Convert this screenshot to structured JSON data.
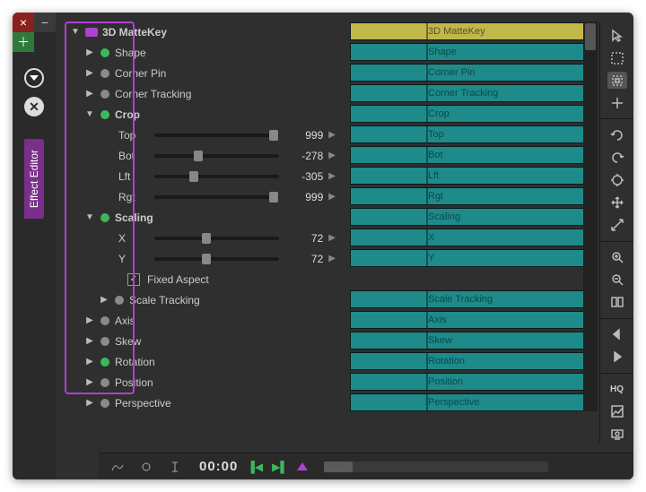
{
  "sidebar": {
    "label": "Effect Editor",
    "close_glyph": "×",
    "minus_glyph": "−",
    "plus_glyph": "＋",
    "x_glyph": "✕"
  },
  "effect": {
    "title": "3D MatteKey",
    "shape": "Shape",
    "corner_pin": "Corner Pin",
    "corner_tracking": "Corner Tracking",
    "crop": {
      "label": "Crop",
      "top": {
        "label": "Top",
        "value": "999",
        "pos": 92
      },
      "bot": {
        "label": "Bot",
        "value": "-278",
        "pos": 32
      },
      "lft": {
        "label": "Lft",
        "value": "-305",
        "pos": 28
      },
      "rgt": {
        "label": "Rgt",
        "value": "999",
        "pos": 92
      }
    },
    "scaling": {
      "label": "Scaling",
      "x": {
        "label": "X",
        "value": "72",
        "pos": 38
      },
      "y": {
        "label": "Y",
        "value": "72",
        "pos": 38
      },
      "fixed_aspect": "Fixed Aspect",
      "checked": "✓"
    },
    "scale_tracking": "Scale Tracking",
    "axis": "Axis",
    "skew": "Skew",
    "rotation": "Rotation",
    "position": "Position",
    "perspective": "Perspective"
  },
  "tracks": {
    "hdr": "3D MatteKey",
    "r1": "Shape",
    "r2": "Corner Pin",
    "r3": "Corner Tracking",
    "r4": "Crop",
    "r5": "Top",
    "r6": "Bot",
    "r7": "Lft",
    "r8": "Rgt",
    "r9": "Scaling",
    "r10": "X",
    "r11": "Y",
    "r12": "Scale Tracking",
    "r13": "Axis",
    "r14": "Skew",
    "r15": "Rotation",
    "r16": "Position",
    "r17": "Perspective"
  },
  "footer": {
    "timecode": "00:00"
  },
  "tools": {
    "hq": "HQ"
  }
}
